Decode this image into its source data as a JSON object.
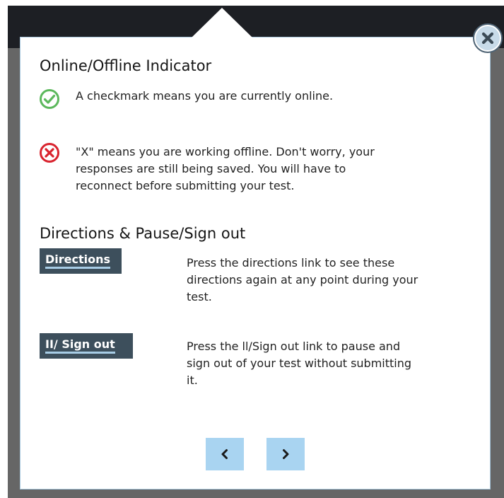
{
  "popup": {
    "close_icon": "close-icon",
    "online_section": {
      "heading": "Online/Offline Indicator",
      "online_text": "A checkmark means you are currently online.",
      "online_icon": "green-checkmark-icon",
      "offline_lines": [
        "\"X\" means you are working offline. Don't worry, your",
        "responses are still being saved. You will have to",
        "reconnect before submitting your test."
      ],
      "offline_icon": "red-x-icon"
    },
    "directions_section": {
      "heading": "Directions & Pause/Sign out",
      "directions_button": "Directions",
      "directions_lines": [
        "Press the directions link to see these",
        "directions again at any point during your",
        "test."
      ],
      "signout_button": "II/ Sign out",
      "signout_lines": [
        "Press the ll/Sign out link to pause and",
        "sign out of your test without submitting",
        "it."
      ]
    },
    "nav": {
      "previous_icon": "chevron-left-icon",
      "next_icon": "chevron-right-icon"
    }
  },
  "colors": {
    "backdrop": "#666666",
    "topbar": "#1d1f24",
    "online_green": "#5cb85c",
    "offline_red": "#d9232e",
    "tool_button": "#3d4f5c",
    "nav_button": "#a9d4f1"
  }
}
